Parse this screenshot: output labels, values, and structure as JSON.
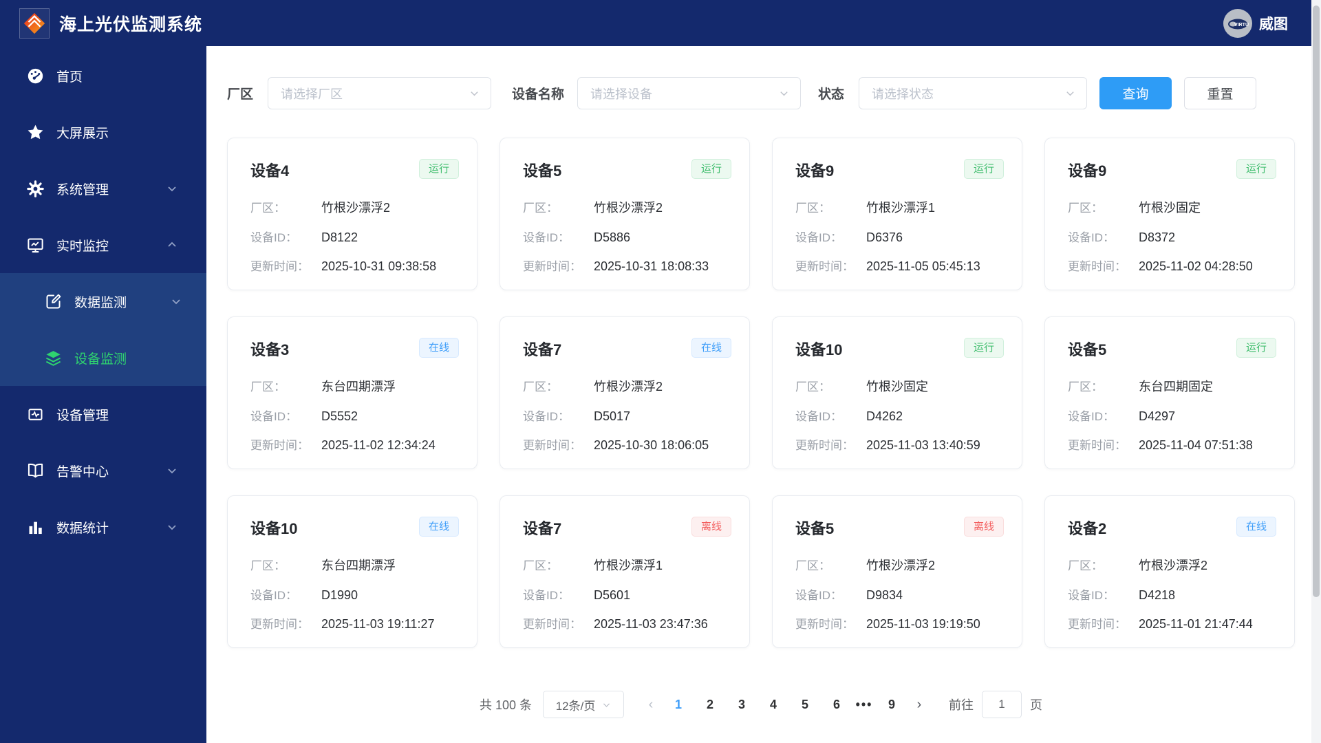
{
  "app": {
    "title": "海上光伏监测系统",
    "brand_logo_text": "VIRTU",
    "brand_name": "威图"
  },
  "sidebar": {
    "items": [
      {
        "label": "首页",
        "icon": "dashboard-icon"
      },
      {
        "label": "大屏展示",
        "icon": "star-icon"
      },
      {
        "label": "系统管理",
        "icon": "gear-icon",
        "chevron": "down"
      },
      {
        "label": "实时监控",
        "icon": "monitor-icon",
        "chevron": "up"
      },
      {
        "label": "数据监测",
        "icon": "edit-icon",
        "chevron": "down"
      },
      {
        "label": "设备监测",
        "icon": "layers-icon",
        "active": true
      },
      {
        "label": "设备管理",
        "icon": "device-screen-icon"
      },
      {
        "label": "告警中心",
        "icon": "book-icon",
        "chevron": "down"
      },
      {
        "label": "数据统计",
        "icon": "bar-chart-icon",
        "chevron": "down"
      }
    ]
  },
  "filters": {
    "farm_label": "厂区",
    "farm_placeholder": "请选择厂区",
    "device_label": "设备名称",
    "device_placeholder": "请选择设备",
    "status_label": "状态",
    "status_placeholder": "请选择状态",
    "search_label": "查询",
    "reset_label": "重置"
  },
  "card_labels": {
    "farm": "厂区：",
    "device_id": "设备ID：",
    "updated": "更新时间："
  },
  "cards": [
    {
      "name": "设备4",
      "status": "运行",
      "status_type": "success",
      "farm": "竹根沙漂浮2",
      "device_id": "D8122",
      "updated": "2025-10-31 09:38:58"
    },
    {
      "name": "设备5",
      "status": "运行",
      "status_type": "success",
      "farm": "竹根沙漂浮2",
      "device_id": "D5886",
      "updated": "2025-10-31 18:08:33"
    },
    {
      "name": "设备9",
      "status": "运行",
      "status_type": "success",
      "farm": "竹根沙漂浮1",
      "device_id": "D6376",
      "updated": "2025-11-05 05:45:13"
    },
    {
      "name": "设备9",
      "status": "运行",
      "status_type": "success",
      "farm": "竹根沙固定",
      "device_id": "D8372",
      "updated": "2025-11-02 04:28:50"
    },
    {
      "name": "设备3",
      "status": "在线",
      "status_type": "primary",
      "farm": "东台四期漂浮",
      "device_id": "D5552",
      "updated": "2025-11-02 12:34:24"
    },
    {
      "name": "设备7",
      "status": "在线",
      "status_type": "primary",
      "farm": "竹根沙漂浮2",
      "device_id": "D5017",
      "updated": "2025-10-30 18:06:05"
    },
    {
      "name": "设备10",
      "status": "运行",
      "status_type": "success",
      "farm": "竹根沙固定",
      "device_id": "D4262",
      "updated": "2025-11-03 13:40:59"
    },
    {
      "name": "设备5",
      "status": "运行",
      "status_type": "success",
      "farm": "东台四期固定",
      "device_id": "D4297",
      "updated": "2025-11-04 07:51:38"
    },
    {
      "name": "设备10",
      "status": "在线",
      "status_type": "primary",
      "farm": "东台四期漂浮",
      "device_id": "D1990",
      "updated": "2025-11-03 19:11:27"
    },
    {
      "name": "设备7",
      "status": "离线",
      "status_type": "danger",
      "farm": "竹根沙漂浮1",
      "device_id": "D5601",
      "updated": "2025-11-03 23:47:36"
    },
    {
      "name": "设备5",
      "status": "离线",
      "status_type": "danger",
      "farm": "竹根沙漂浮2",
      "device_id": "D9834",
      "updated": "2025-11-03 19:19:50"
    },
    {
      "name": "设备2",
      "status": "在线",
      "status_type": "primary",
      "farm": "竹根沙漂浮2",
      "device_id": "D4218",
      "updated": "2025-11-01 21:47:44"
    }
  ],
  "pagination": {
    "total_text": "共 100 条",
    "page_size": "12条/页",
    "prev": "‹",
    "pages": [
      "1",
      "2",
      "3",
      "4",
      "5",
      "6"
    ],
    "active_page": "1",
    "ellipsis": "•••",
    "last_page": "9",
    "next": "›",
    "goto_label": "前往",
    "goto_value": "1",
    "goto_suffix": "页"
  },
  "colors": {
    "navy": "#14296d",
    "submenu_navy": "#20407f",
    "active_green": "#2fd36f",
    "primary_blue": "#2e9cf6",
    "success_badge": "#3fbd6d",
    "online_badge": "#3f9ef9",
    "offline_badge": "#f35d5d"
  }
}
